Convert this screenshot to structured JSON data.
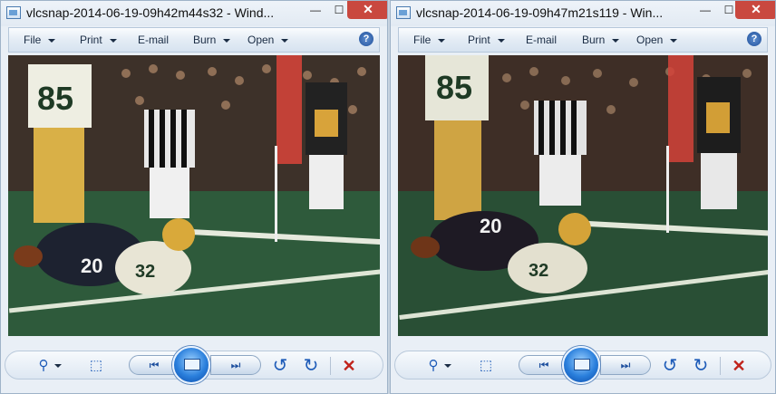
{
  "windows": [
    {
      "title": "vlcsnap-2014-06-19-09h42m44s32 - Wind...",
      "menu": [
        "File",
        "Print",
        "E-mail",
        "Burn",
        "Open"
      ],
      "help": "?",
      "caption_minimize": "—",
      "caption_maximize": "☐",
      "caption_close": "✕",
      "nav": {
        "zoom": "⚲",
        "fit": "⬚",
        "prev": "⏮",
        "next": "⏭",
        "rotate_ccw": "↺",
        "rotate_cw": "↻",
        "delete": "✕"
      },
      "image": {
        "jersey_a": "85",
        "jersey_b": "32",
        "jersey_c": "20"
      }
    },
    {
      "title": "vlcsnap-2014-06-19-09h47m21s119 - Win...",
      "menu": [
        "File",
        "Print",
        "E-mail",
        "Burn",
        "Open"
      ],
      "help": "?",
      "caption_minimize": "—",
      "caption_maximize": "☐",
      "caption_close": "✕",
      "nav": {
        "zoom": "⚲",
        "fit": "⬚",
        "prev": "⏮",
        "next": "⏭",
        "rotate_ccw": "↺",
        "rotate_cw": "↻",
        "delete": "✕"
      },
      "image": {
        "jersey_a": "85",
        "jersey_b": "32",
        "jersey_c": "20"
      }
    }
  ],
  "colors": {
    "accent": "#1d5bb8",
    "close": "#c9483f",
    "field": "#2f5a3a"
  }
}
